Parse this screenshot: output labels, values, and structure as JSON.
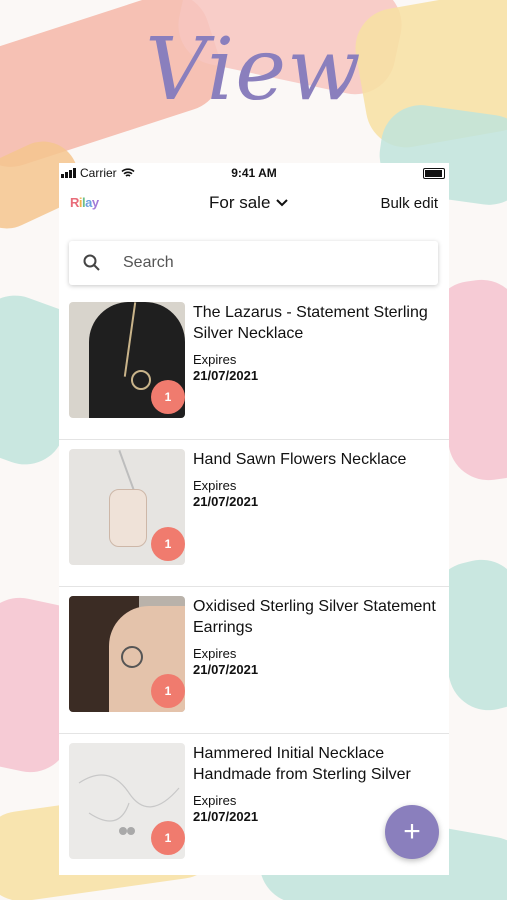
{
  "hero": {
    "title": "View"
  },
  "status": {
    "carrier": "Carrier",
    "time": "9:41 AM"
  },
  "appbar": {
    "logo": [
      "R",
      "i",
      "l",
      "a",
      "y"
    ],
    "filter_label": "For sale",
    "bulk_label": "Bulk edit"
  },
  "search": {
    "placeholder": "Search"
  },
  "listings": [
    {
      "title": "The Lazarus - Statement Sterling Silver Necklace",
      "expires_label": "Expires",
      "expires_date": "21/07/2021",
      "count": "1"
    },
    {
      "title": "Hand Sawn Flowers Necklace",
      "expires_label": "Expires",
      "expires_date": "21/07/2021",
      "count": "1"
    },
    {
      "title": "Oxidised Sterling Silver Statement Earrings",
      "expires_label": "Expires",
      "expires_date": "21/07/2021",
      "count": "1"
    },
    {
      "title": "Hammered Initial Necklace Handmade from Sterling Silver",
      "expires_label": "Expires",
      "expires_date": "21/07/2021",
      "count": "1"
    }
  ],
  "fab": {
    "label": "+"
  },
  "colors": {
    "accent": "#8a7fbd",
    "badge": "#f07b6e"
  }
}
